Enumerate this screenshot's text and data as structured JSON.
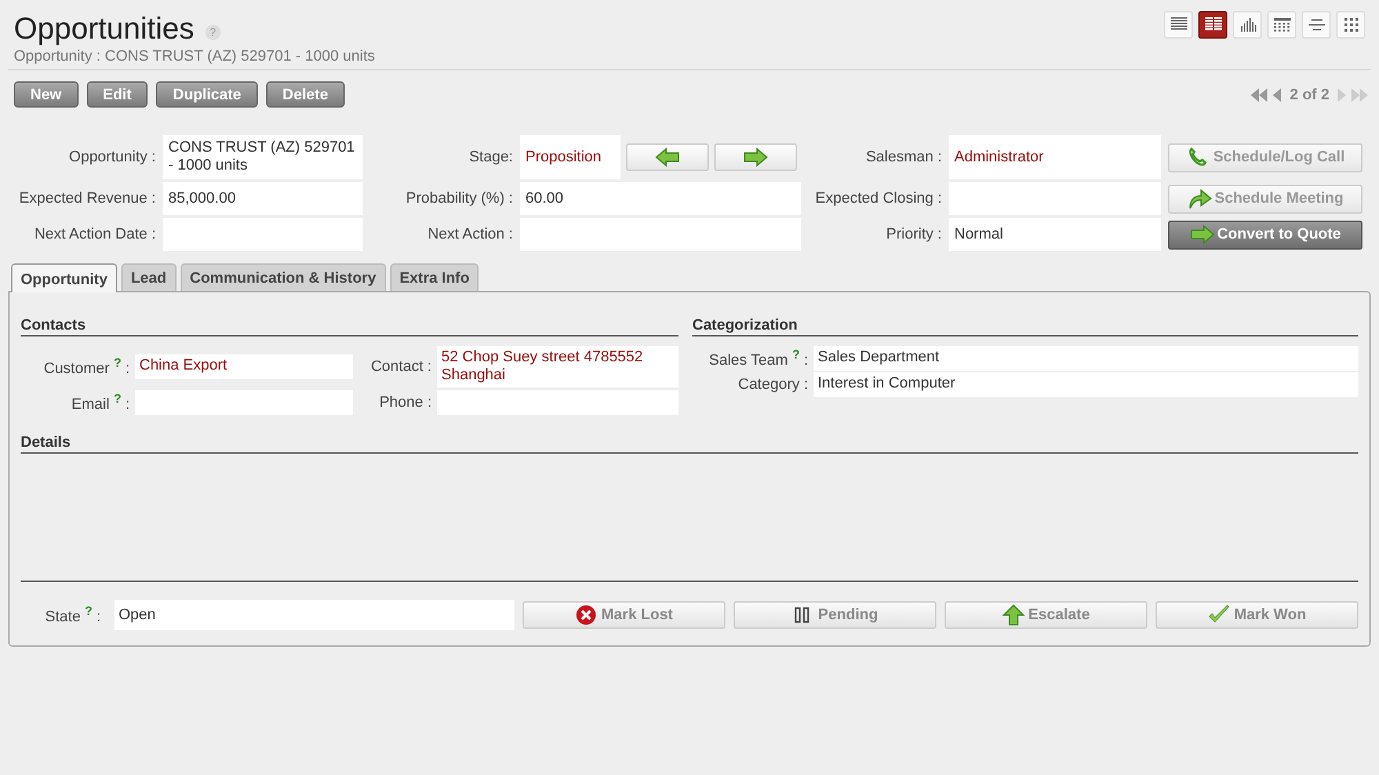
{
  "header": {
    "title": "Opportunities",
    "help": "?",
    "subtitle": "Opportunity : CONS TRUST (AZ) 529701 - 1000 units"
  },
  "views": [
    {
      "kind": "list",
      "selected": false
    },
    {
      "kind": "form",
      "selected": true
    },
    {
      "kind": "graph",
      "selected": false
    },
    {
      "kind": "calendar",
      "selected": false
    },
    {
      "kind": "gantt",
      "selected": false
    },
    {
      "kind": "kanban",
      "selected": false
    }
  ],
  "actions": [
    "New",
    "Edit",
    "Duplicate",
    "Delete"
  ],
  "pager": {
    "text": "2 of 2",
    "buttons": [
      {
        "kind": "first",
        "disabled": false
      },
      {
        "kind": "previous",
        "disabled": false
      },
      {
        "kind": "next",
        "disabled": true
      },
      {
        "kind": "last",
        "disabled": true
      }
    ]
  },
  "form_rows": [
    {
      "fields": [
        {
          "label": "Opportunity :",
          "value": "CONS TRUST (AZ) 529701 - 1000 units",
          "link": false
        },
        {
          "label": "Stage:",
          "value": "Proposition",
          "link": true,
          "kind": "stage"
        },
        {
          "label": "Salesman :",
          "value": "Administrator",
          "link": true
        }
      ],
      "button": {
        "label": "Schedule/Log Call",
        "kind": "phone",
        "primary": false
      }
    },
    {
      "fields": [
        {
          "label": "Expected Revenue :",
          "value": "85,000.00",
          "link": false
        },
        {
          "label": "Probability (%) :",
          "value": "60.00",
          "link": false
        },
        {
          "label": "Expected Closing :"
        }
      ],
      "button": {
        "label": "Schedule Meeting",
        "kind": "curved-arrow",
        "primary": false
      }
    },
    {
      "fields": [
        {
          "label": "Next Action Date :"
        },
        {
          "label": "Next Action :"
        },
        {
          "label": "Priority :",
          "value": "Normal",
          "link": false
        }
      ],
      "button": {
        "label": "Convert to Quote",
        "kind": "arrow",
        "primary": true
      }
    }
  ],
  "tabs": [
    {
      "label": "Opportunity",
      "selected": true
    },
    {
      "label": "Lead",
      "selected": false
    },
    {
      "label": "Communication & History",
      "selected": false
    },
    {
      "label": "Extra Info",
      "selected": false
    }
  ],
  "contacts": {
    "title": "Contacts",
    "fields": [
      {
        "label": "Customer",
        "help": "?",
        "separator": ":",
        "value": "China Export",
        "link": true
      },
      {
        "label": "Contact :",
        "value": "52 Chop Suey street 4785552 Shanghai",
        "link": true
      },
      {
        "label": "Email",
        "help": "?",
        "separator": ":"
      },
      {
        "label": "Phone :"
      }
    ]
  },
  "categorization": {
    "title": "Categorization",
    "fields": [
      {
        "label": "Sales Team",
        "help": "?",
        "separator": ":",
        "value": "Sales Department",
        "link": false
      },
      {
        "label": "Category :",
        "value": "Interest in Computer",
        "link": false
      }
    ]
  },
  "details": {
    "title": "Details"
  },
  "state": {
    "label": "State",
    "help": "?",
    "separator": ":",
    "value": "Open",
    "buttons": [
      {
        "label": "Mark Lost",
        "kind": "cross"
      },
      {
        "label": "Pending",
        "kind": "pause"
      },
      {
        "label": "Escalate",
        "kind": "up"
      },
      {
        "label": "Mark Won",
        "kind": "check"
      }
    ]
  }
}
